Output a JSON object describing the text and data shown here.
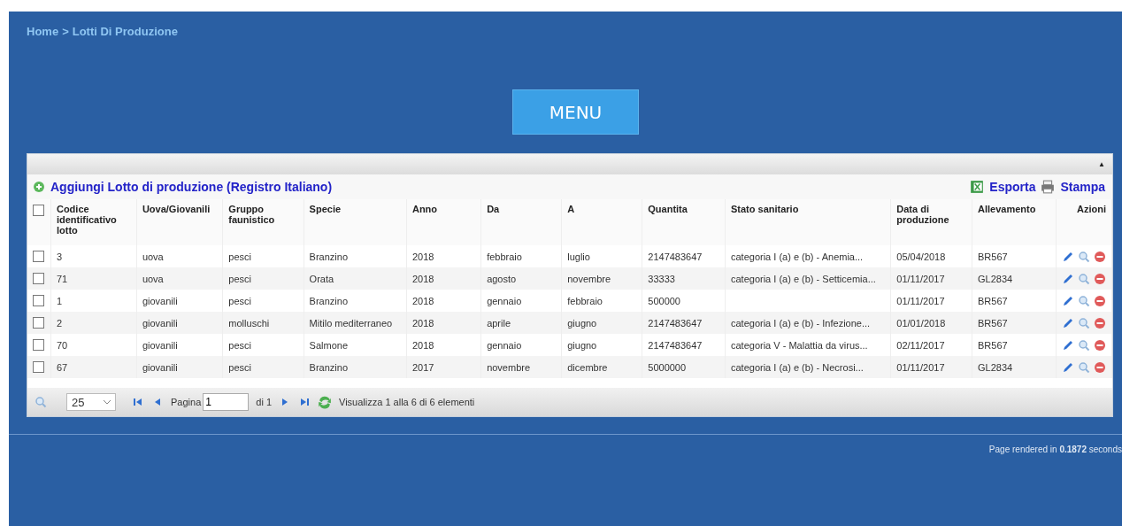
{
  "breadcrumb": {
    "home": "Home",
    "separator": ">",
    "current": "Lotti Di Produzione"
  },
  "menu_button": "MENU",
  "grid": {
    "collapse_icon": "▲",
    "add_link": "Aggiungi Lotto di produzione (Registro Italiano)",
    "export_link": "Esporta",
    "print_link": "Stampa",
    "select_all": {
      "checked": false
    },
    "columns": [
      "Codice identificativo lotto",
      "Uova/Giovanili",
      "Gruppo faunistico",
      "Specie",
      "Anno",
      "Da",
      "A",
      "Quantita",
      "Stato sanitario",
      "Data di produzione",
      "Allevamento",
      "Azioni"
    ],
    "rows": [
      {
        "checked": false,
        "cells": [
          "3",
          "uova",
          "pesci",
          "Branzino",
          "2018",
          "febbraio",
          "luglio",
          "2147483647",
          "categoria I (a) e (b) - Anemia...",
          "05/04/2018",
          "BR567"
        ]
      },
      {
        "checked": false,
        "cells": [
          "71",
          "uova",
          "pesci",
          "Orata",
          "2018",
          "agosto",
          "novembre",
          "33333",
          "categoria I (a) e (b) - Setticemia...",
          "01/11/2017",
          "GL2834"
        ]
      },
      {
        "checked": false,
        "cells": [
          "1",
          "giovanili",
          "pesci",
          "Branzino",
          "2018",
          "gennaio",
          "febbraio",
          "500000",
          "",
          "01/11/2017",
          "BR567"
        ]
      },
      {
        "checked": false,
        "cells": [
          "2",
          "giovanili",
          "molluschi",
          "Mitilo mediterraneo",
          "2018",
          "aprile",
          "giugno",
          "2147483647",
          "categoria I (a) e (b) - Infezione...",
          "01/01/2018",
          "BR567"
        ]
      },
      {
        "checked": false,
        "cells": [
          "70",
          "giovanili",
          "pesci",
          "Salmone",
          "2018",
          "gennaio",
          "giugno",
          "2147483647",
          "categoria V - Malattia da virus...",
          "02/11/2017",
          "BR567"
        ]
      },
      {
        "checked": false,
        "cells": [
          "67",
          "giovanili",
          "pesci",
          "Branzino",
          "2017",
          "novembre",
          "dicembre",
          "5000000",
          "categoria I (a) e (b) - Necrosi...",
          "01/11/2017",
          "GL2834"
        ]
      }
    ],
    "pager": {
      "page_size": "25",
      "page_label": "Pagina",
      "page_value": "1",
      "page_total": "di 1",
      "summary": "Visualizza 1 alla 6 di 6 elementi"
    }
  },
  "footer": "Page rendered in **0.1872** seconds"
}
